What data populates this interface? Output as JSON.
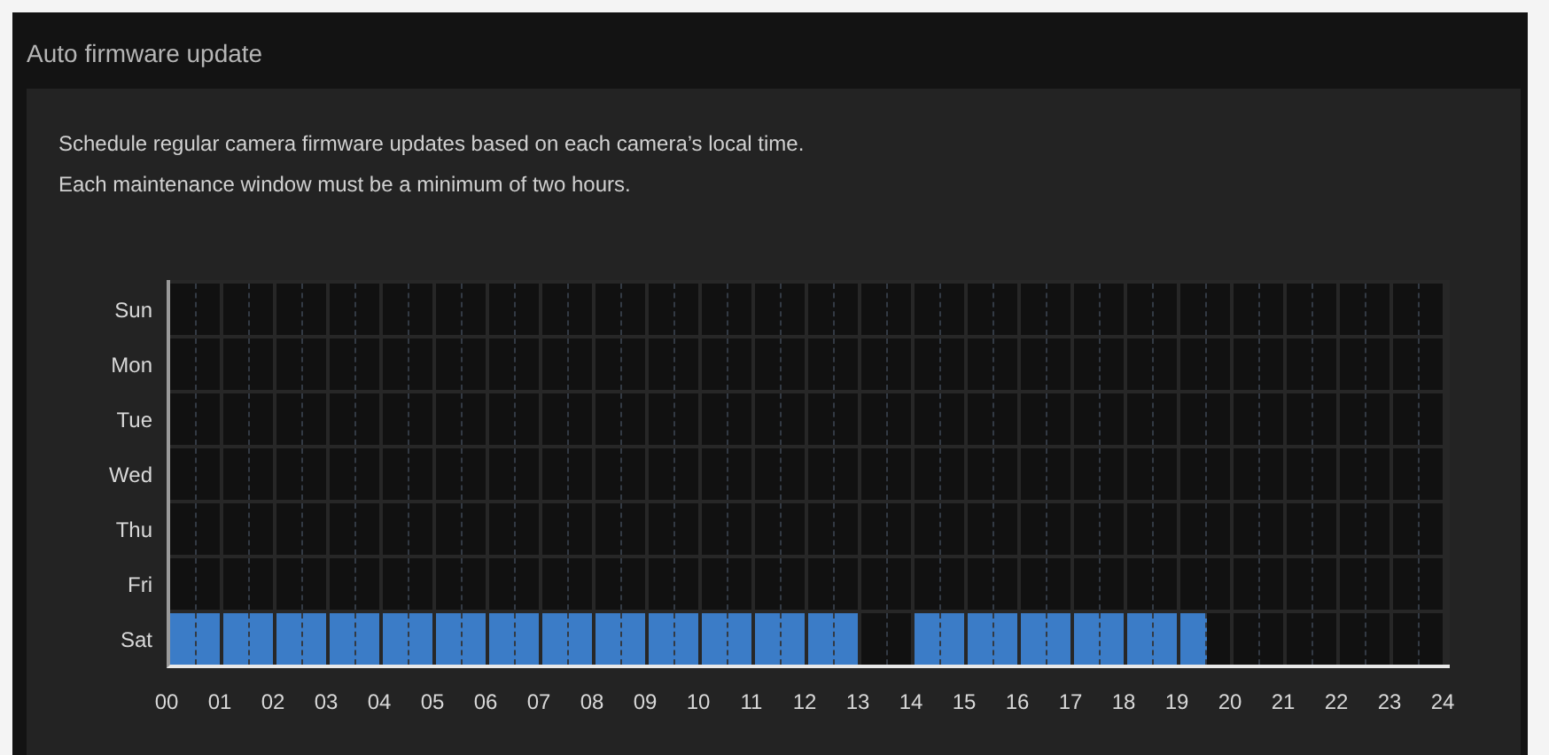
{
  "title": "Auto firmware update",
  "description": [
    "Schedule regular camera firmware updates based on each camera’s local time.",
    "Each maintenance window must be a minimum of two hours."
  ],
  "days": [
    {
      "label": "Sun",
      "slots": [
        false,
        false,
        false,
        false,
        false,
        false,
        false,
        false,
        false,
        false,
        false,
        false,
        false,
        false,
        false,
        false,
        false,
        false,
        false,
        false,
        false,
        false,
        false,
        false,
        false,
        false,
        false,
        false,
        false,
        false,
        false,
        false,
        false,
        false,
        false,
        false,
        false,
        false,
        false,
        false,
        false,
        false,
        false,
        false,
        false,
        false,
        false,
        false
      ]
    },
    {
      "label": "Mon",
      "slots": [
        false,
        false,
        false,
        false,
        false,
        false,
        false,
        false,
        false,
        false,
        false,
        false,
        false,
        false,
        false,
        false,
        false,
        false,
        false,
        false,
        false,
        false,
        false,
        false,
        false,
        false,
        false,
        false,
        false,
        false,
        false,
        false,
        false,
        false,
        false,
        false,
        false,
        false,
        false,
        false,
        false,
        false,
        false,
        false,
        false,
        false,
        false,
        false
      ]
    },
    {
      "label": "Tue",
      "slots": [
        false,
        false,
        false,
        false,
        false,
        false,
        false,
        false,
        false,
        false,
        false,
        false,
        false,
        false,
        false,
        false,
        false,
        false,
        false,
        false,
        false,
        false,
        false,
        false,
        false,
        false,
        false,
        false,
        false,
        false,
        false,
        false,
        false,
        false,
        false,
        false,
        false,
        false,
        false,
        false,
        false,
        false,
        false,
        false,
        false,
        false,
        false,
        false
      ]
    },
    {
      "label": "Wed",
      "slots": [
        false,
        false,
        false,
        false,
        false,
        false,
        false,
        false,
        false,
        false,
        false,
        false,
        false,
        false,
        false,
        false,
        false,
        false,
        false,
        false,
        false,
        false,
        false,
        false,
        false,
        false,
        false,
        false,
        false,
        false,
        false,
        false,
        false,
        false,
        false,
        false,
        false,
        false,
        false,
        false,
        false,
        false,
        false,
        false,
        false,
        false,
        false,
        false
      ]
    },
    {
      "label": "Thu",
      "slots": [
        false,
        false,
        false,
        false,
        false,
        false,
        false,
        false,
        false,
        false,
        false,
        false,
        false,
        false,
        false,
        false,
        false,
        false,
        false,
        false,
        false,
        false,
        false,
        false,
        false,
        false,
        false,
        false,
        false,
        false,
        false,
        false,
        false,
        false,
        false,
        false,
        false,
        false,
        false,
        false,
        false,
        false,
        false,
        false,
        false,
        false,
        false,
        false
      ]
    },
    {
      "label": "Fri",
      "slots": [
        false,
        false,
        false,
        false,
        false,
        false,
        false,
        false,
        false,
        false,
        false,
        false,
        false,
        false,
        false,
        false,
        false,
        false,
        false,
        false,
        false,
        false,
        false,
        false,
        false,
        false,
        false,
        false,
        false,
        false,
        false,
        false,
        false,
        false,
        false,
        false,
        false,
        false,
        false,
        false,
        false,
        false,
        false,
        false,
        false,
        false,
        false,
        false
      ]
    },
    {
      "label": "Sat",
      "slots": [
        true,
        true,
        true,
        true,
        true,
        true,
        true,
        true,
        true,
        true,
        true,
        true,
        true,
        true,
        true,
        true,
        true,
        true,
        true,
        true,
        true,
        true,
        true,
        true,
        true,
        true,
        false,
        false,
        true,
        true,
        true,
        true,
        true,
        true,
        true,
        true,
        true,
        true,
        true,
        false,
        false,
        false,
        false,
        false,
        false,
        false,
        false,
        false
      ]
    }
  ],
  "hours": [
    "00",
    "01",
    "02",
    "03",
    "04",
    "05",
    "06",
    "07",
    "08",
    "09",
    "10",
    "11",
    "12",
    "13",
    "14",
    "15",
    "16",
    "17",
    "18",
    "19",
    "20",
    "21",
    "22",
    "23",
    "24"
  ]
}
